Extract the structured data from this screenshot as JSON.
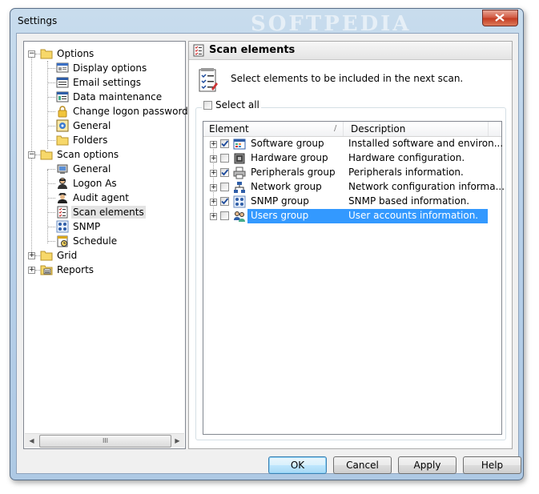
{
  "window": {
    "title": "Settings",
    "watermark": "SOFTPEDIA"
  },
  "tree": {
    "items": [
      {
        "label": "Options",
        "level": 0,
        "expanded": true,
        "icon": "folder-icon"
      },
      {
        "label": "Display options",
        "level": 1,
        "icon": "display-icon"
      },
      {
        "label": "Email settings",
        "level": 1,
        "icon": "email-icon"
      },
      {
        "label": "Data maintenance",
        "level": 1,
        "icon": "database-icon"
      },
      {
        "label": "Change logon password",
        "level": 1,
        "icon": "lock-icon"
      },
      {
        "label": "General",
        "level": 1,
        "icon": "general-icon"
      },
      {
        "label": "Folders",
        "level": 1,
        "icon": "folder-icon"
      },
      {
        "label": "Scan options",
        "level": 0,
        "expanded": true,
        "icon": "folder-icon"
      },
      {
        "label": "General",
        "level": 1,
        "icon": "general-icon"
      },
      {
        "label": "Logon As",
        "level": 1,
        "icon": "user-icon"
      },
      {
        "label": "Audit agent",
        "level": 1,
        "icon": "agent-icon"
      },
      {
        "label": "Scan elements",
        "level": 1,
        "icon": "checklist-icon",
        "selected": true
      },
      {
        "label": "SNMP",
        "level": 1,
        "icon": "network-icon"
      },
      {
        "label": "Schedule",
        "level": 1,
        "icon": "schedule-icon"
      },
      {
        "label": "Grid",
        "level": 0,
        "expanded": false,
        "icon": "folder-icon"
      },
      {
        "label": "Reports",
        "level": 0,
        "expanded": false,
        "icon": "reports-icon"
      }
    ],
    "scroll_thumb": "III"
  },
  "panel": {
    "title": "Scan elements",
    "description": "Select elements to be included in the next scan.",
    "select_all_label": "Select all",
    "columns": {
      "element": "Element",
      "sort_glyph": "/",
      "description": "Description"
    },
    "rows": [
      {
        "element": "Software group",
        "description": "Installed software and environ...",
        "checked": true,
        "icon": "software-icon"
      },
      {
        "element": "Hardware group",
        "description": "Hardware configuration.",
        "checked": false,
        "icon": "hardware-icon"
      },
      {
        "element": "Peripherals group",
        "description": "Peripherals information.",
        "checked": true,
        "icon": "printer-icon"
      },
      {
        "element": "Network group",
        "description": "Network configuration informa...",
        "checked": false,
        "icon": "network-icon"
      },
      {
        "element": "SNMP group",
        "description": "SNMP based information.",
        "checked": true,
        "icon": "snmp-icon"
      },
      {
        "element": "Users group",
        "description": "User accounts information.",
        "checked": false,
        "icon": "users-icon",
        "highlighted": true
      }
    ]
  },
  "buttons": {
    "ok": "OK",
    "cancel": "Cancel",
    "apply": "Apply",
    "help": "Help"
  },
  "colors": {
    "selection": "#3399ff",
    "check": "#1c4a9c"
  }
}
